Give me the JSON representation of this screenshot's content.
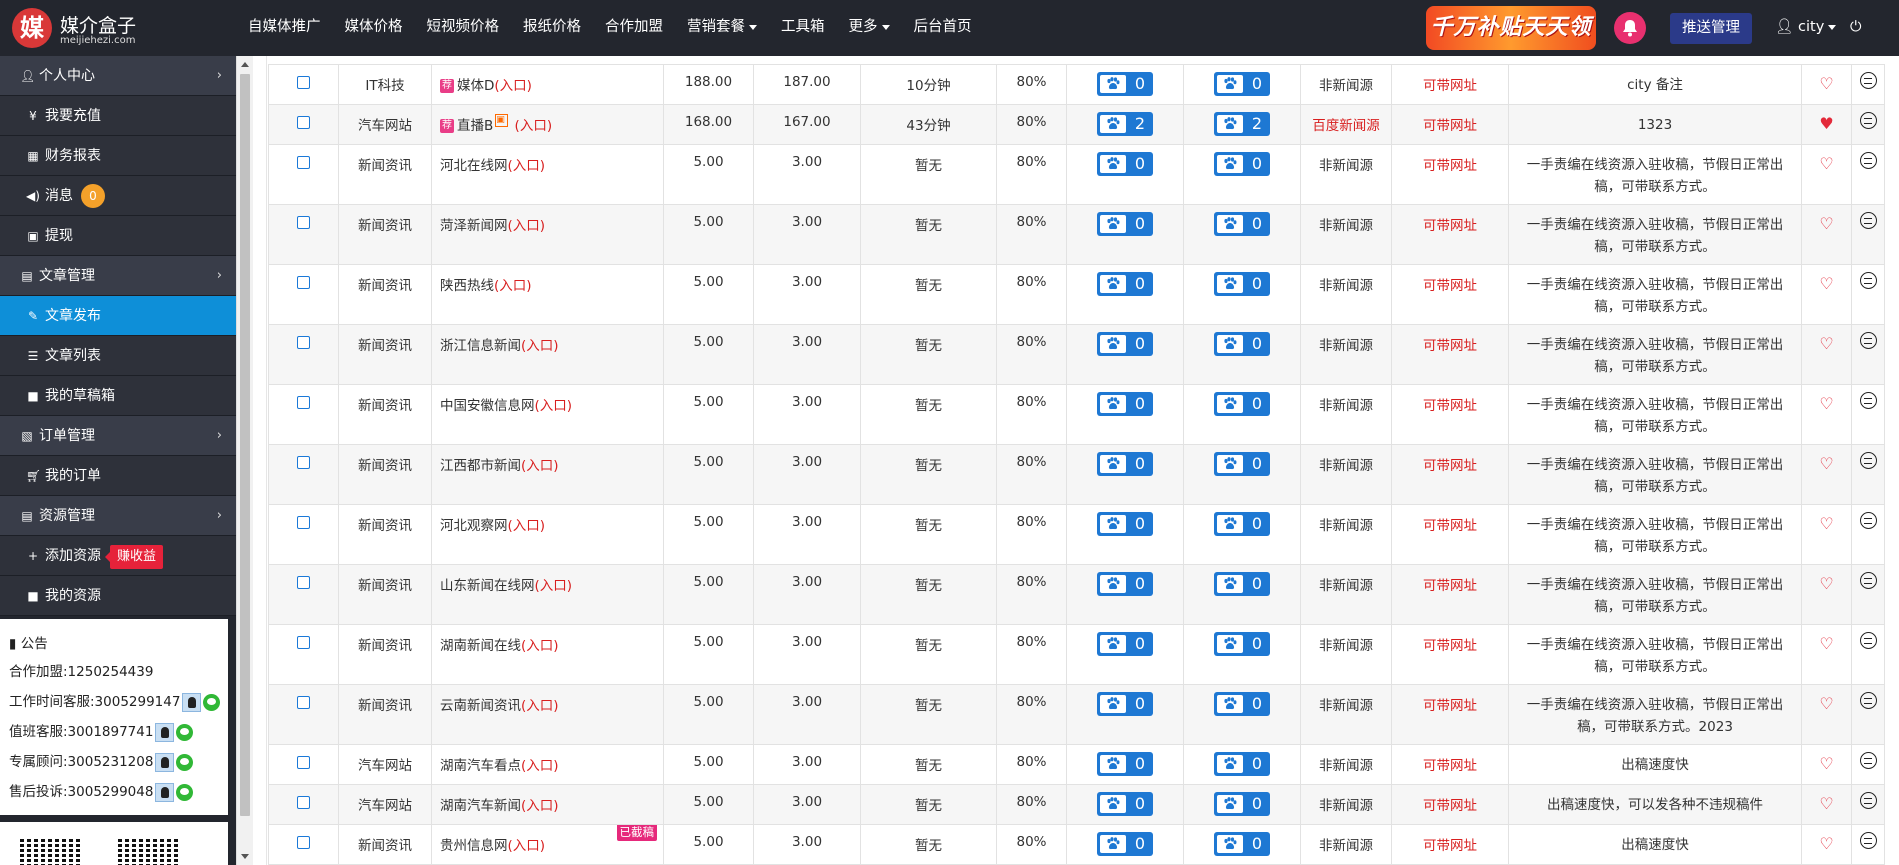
{
  "app": {
    "logo_char": "媒",
    "logo_name": "媒介盒子",
    "logo_domain": "meijiehezi.com",
    "nav": [
      {
        "label": "自媒体推广",
        "dropdown": false
      },
      {
        "label": "媒体价格",
        "dropdown": false
      },
      {
        "label": "短视频价格",
        "dropdown": false
      },
      {
        "label": "报纸价格",
        "dropdown": false
      },
      {
        "label": "合作加盟",
        "dropdown": false
      },
      {
        "label": "营销套餐",
        "dropdown": true
      },
      {
        "label": "工具箱",
        "dropdown": false
      },
      {
        "label": "更多",
        "dropdown": true
      },
      {
        "label": "后台首页",
        "dropdown": false
      }
    ],
    "promo_text": "千万补贴天天领",
    "push_label": "推送管理",
    "user_name": "city",
    "logout_glyph": "⏻"
  },
  "sidebar": {
    "sections": [
      {
        "label": "个人中心",
        "icon": "user-icon",
        "items": [
          {
            "label": "我要充值",
            "icon": "yen-icon"
          },
          {
            "label": "财务报表",
            "icon": "table-icon"
          },
          {
            "label": "消息",
            "icon": "volume-icon",
            "badge": "0"
          },
          {
            "label": "提现",
            "icon": "wallet-icon"
          }
        ]
      },
      {
        "label": "文章管理",
        "icon": "book-icon",
        "items": [
          {
            "label": "文章发布",
            "icon": "edit-icon",
            "active": true
          },
          {
            "label": "文章列表",
            "icon": "list-icon"
          },
          {
            "label": "我的草稿箱",
            "icon": "video-icon"
          }
        ]
      },
      {
        "label": "订单管理",
        "icon": "folder-icon",
        "items": [
          {
            "label": "我的订单",
            "icon": "cart-icon"
          }
        ]
      },
      {
        "label": "资源管理",
        "icon": "book-icon",
        "items": [
          {
            "label": "添加资源",
            "icon": "plus-icon",
            "badge": "赚收益"
          },
          {
            "label": "我的资源",
            "icon": "video-icon"
          }
        ]
      }
    ],
    "notice": {
      "title": "公告",
      "lines": [
        {
          "text": "合作加盟:1250254439",
          "qq": false,
          "wx": false
        },
        {
          "text": "工作时间客服:3005299147",
          "qq": true,
          "wx": true
        },
        {
          "text": "值班客服:3001897741",
          "qq": true,
          "wx": true
        },
        {
          "text": "专属顾问:3005231208",
          "qq": true,
          "wx": true
        },
        {
          "text": "售后投诉:3005299048",
          "qq": true,
          "wx": true
        }
      ]
    }
  },
  "table": {
    "rows": [
      {
        "cat": "IT科技",
        "tag": "荐",
        "live": false,
        "name": "媒体D",
        "entry": "(入口)",
        "price1": "188.00",
        "price2": "187.00",
        "speed": "10分钟",
        "rate": "80%",
        "paw1": "0",
        "paw2": "0",
        "source": "非新闻源",
        "source_red": false,
        "link": "可带网址",
        "note": "city 备注",
        "fav": true,
        "fav_filled": false,
        "sold": false
      },
      {
        "cat": "汽车网站",
        "tag": "荐",
        "live": true,
        "name": "直播B",
        "entry": " (入口)",
        "price1": "168.00",
        "price2": "167.00",
        "speed": "43分钟",
        "rate": "80%",
        "paw1": "2",
        "paw2": "2",
        "source": "百度新闻源",
        "source_red": true,
        "link": "可带网址",
        "note": "1323",
        "fav": true,
        "fav_filled": true,
        "sold": false
      },
      {
        "cat": "新闻资讯",
        "tag": "",
        "live": false,
        "name": "河北在线网",
        "entry": "(入口)",
        "price1": "5.00",
        "price2": "3.00",
        "speed": "暂无",
        "rate": "80%",
        "paw1": "0",
        "paw2": "0",
        "source": "非新闻源",
        "source_red": false,
        "link": "可带网址",
        "note": "一手责编在线资源入驻收稿，节假日正常出稿，可带联系方式。",
        "fav": true,
        "fav_filled": false,
        "sold": false
      },
      {
        "cat": "新闻资讯",
        "tag": "",
        "live": false,
        "name": "菏泽新闻网",
        "entry": "(入口)",
        "price1": "5.00",
        "price2": "3.00",
        "speed": "暂无",
        "rate": "80%",
        "paw1": "0",
        "paw2": "0",
        "source": "非新闻源",
        "source_red": false,
        "link": "可带网址",
        "note": "一手责编在线资源入驻收稿，节假日正常出稿，可带联系方式。",
        "fav": true,
        "fav_filled": false,
        "sold": false
      },
      {
        "cat": "新闻资讯",
        "tag": "",
        "live": false,
        "name": "陕西热线",
        "entry": "(入口)",
        "price1": "5.00",
        "price2": "3.00",
        "speed": "暂无",
        "rate": "80%",
        "paw1": "0",
        "paw2": "0",
        "source": "非新闻源",
        "source_red": false,
        "link": "可带网址",
        "note": "一手责编在线资源入驻收稿，节假日正常出稿，可带联系方式。",
        "fav": true,
        "fav_filled": false,
        "sold": false
      },
      {
        "cat": "新闻资讯",
        "tag": "",
        "live": false,
        "name": "浙江信息新闻",
        "entry": "(入口)",
        "price1": "5.00",
        "price2": "3.00",
        "speed": "暂无",
        "rate": "80%",
        "paw1": "0",
        "paw2": "0",
        "source": "非新闻源",
        "source_red": false,
        "link": "可带网址",
        "note": "一手责编在线资源入驻收稿，节假日正常出稿，可带联系方式。",
        "fav": true,
        "fav_filled": false,
        "sold": false
      },
      {
        "cat": "新闻资讯",
        "tag": "",
        "live": false,
        "name": "中国安徽信息网",
        "entry": "(入口)",
        "price1": "5.00",
        "price2": "3.00",
        "speed": "暂无",
        "rate": "80%",
        "paw1": "0",
        "paw2": "0",
        "source": "非新闻源",
        "source_red": false,
        "link": "可带网址",
        "note": "一手责编在线资源入驻收稿，节假日正常出稿，可带联系方式。",
        "fav": true,
        "fav_filled": false,
        "sold": false
      },
      {
        "cat": "新闻资讯",
        "tag": "",
        "live": false,
        "name": "江西都市新闻",
        "entry": "(入口)",
        "price1": "5.00",
        "price2": "3.00",
        "speed": "暂无",
        "rate": "80%",
        "paw1": "0",
        "paw2": "0",
        "source": "非新闻源",
        "source_red": false,
        "link": "可带网址",
        "note": "一手责编在线资源入驻收稿，节假日正常出稿，可带联系方式。",
        "fav": true,
        "fav_filled": false,
        "sold": false
      },
      {
        "cat": "新闻资讯",
        "tag": "",
        "live": false,
        "name": "河北观察网",
        "entry": "(入口)",
        "price1": "5.00",
        "price2": "3.00",
        "speed": "暂无",
        "rate": "80%",
        "paw1": "0",
        "paw2": "0",
        "source": "非新闻源",
        "source_red": false,
        "link": "可带网址",
        "note": "一手责编在线资源入驻收稿，节假日正常出稿，可带联系方式。",
        "fav": true,
        "fav_filled": false,
        "sold": false
      },
      {
        "cat": "新闻资讯",
        "tag": "",
        "live": false,
        "name": "山东新闻在线网",
        "entry": "(入口)",
        "price1": "5.00",
        "price2": "3.00",
        "speed": "暂无",
        "rate": "80%",
        "paw1": "0",
        "paw2": "0",
        "source": "非新闻源",
        "source_red": false,
        "link": "可带网址",
        "note": "一手责编在线资源入驻收稿，节假日正常出稿，可带联系方式。",
        "fav": true,
        "fav_filled": false,
        "sold": false
      },
      {
        "cat": "新闻资讯",
        "tag": "",
        "live": false,
        "name": "湖南新闻在线",
        "entry": "(入口)",
        "price1": "5.00",
        "price2": "3.00",
        "speed": "暂无",
        "rate": "80%",
        "paw1": "0",
        "paw2": "0",
        "source": "非新闻源",
        "source_red": false,
        "link": "可带网址",
        "note": "一手责编在线资源入驻收稿，节假日正常出稿，可带联系方式。",
        "fav": true,
        "fav_filled": false,
        "sold": false
      },
      {
        "cat": "新闻资讯",
        "tag": "",
        "live": false,
        "name": "云南新闻资讯",
        "entry": "(入口)",
        "price1": "5.00",
        "price2": "3.00",
        "speed": "暂无",
        "rate": "80%",
        "paw1": "0",
        "paw2": "0",
        "source": "非新闻源",
        "source_red": false,
        "link": "可带网址",
        "note": "一手责编在线资源入驻收稿，节假日正常出稿，可带联系方式。2023",
        "fav": true,
        "fav_filled": false,
        "sold": false
      },
      {
        "cat": "汽车网站",
        "tag": "",
        "live": false,
        "name": "湖南汽车看点",
        "entry": "(入口)",
        "price1": "5.00",
        "price2": "3.00",
        "speed": "暂无",
        "rate": "80%",
        "paw1": "0",
        "paw2": "0",
        "source": "非新闻源",
        "source_red": false,
        "link": "可带网址",
        "note": "出稿速度快",
        "fav": true,
        "fav_filled": false,
        "sold": false
      },
      {
        "cat": "汽车网站",
        "tag": "",
        "live": false,
        "name": "湖南汽车新闻",
        "entry": "(入口)",
        "price1": "5.00",
        "price2": "3.00",
        "speed": "暂无",
        "rate": "80%",
        "paw1": "0",
        "paw2": "0",
        "source": "非新闻源",
        "source_red": false,
        "link": "可带网址",
        "note": "出稿速度快，可以发各种不违规稿件",
        "fav": true,
        "fav_filled": false,
        "sold": false
      },
      {
        "cat": "新闻资讯",
        "tag": "",
        "live": false,
        "name": "贵州信息网",
        "entry": "(入口)",
        "price1": "5.00",
        "price2": "3.00",
        "speed": "暂无",
        "rate": "80%",
        "paw1": "0",
        "paw2": "0",
        "source": "非新闻源",
        "source_red": false,
        "link": "可带网址",
        "note": "出稿速度快",
        "fav": true,
        "fav_filled": false,
        "sold": true,
        "sold_label": "已截稿"
      }
    ]
  },
  "colors": {
    "topbar": "#23262e",
    "sidebar_active": "#0e8fd8",
    "accent_blue": "#1e78d3",
    "accent_red": "#d81f1f"
  }
}
